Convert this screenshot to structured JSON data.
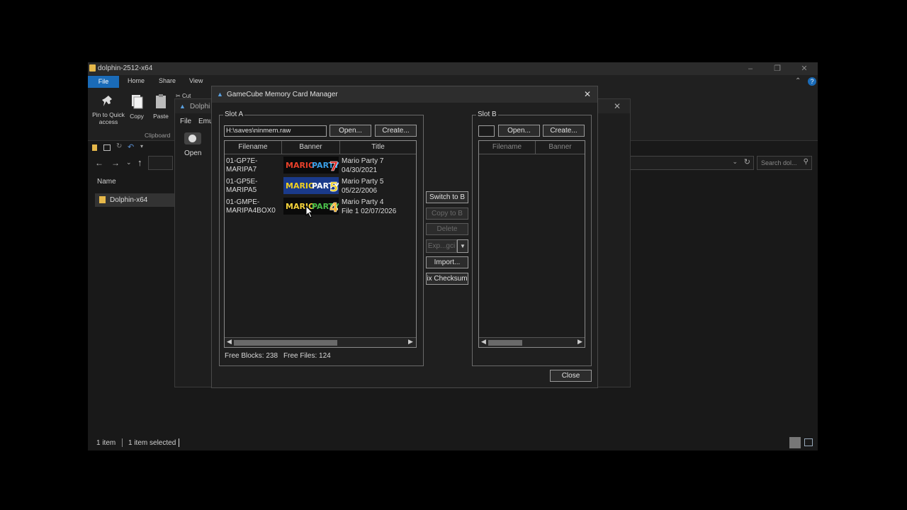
{
  "explorer": {
    "title": "dolphin-2512-x64",
    "tabs": [
      "File",
      "Home",
      "Share",
      "View"
    ],
    "ribbon": {
      "pin_label": "Pin to Quick access",
      "copy_label": "Copy",
      "paste_label": "Paste",
      "cut_label": "Cut",
      "group_label": "Clipboard"
    },
    "search_placeholder": "Search dol...",
    "column_name": "Name",
    "sidebar_item": "Dolphin-x64",
    "status_items": "1 item",
    "status_selected": "1 item selected"
  },
  "dolphin": {
    "title": "Dolphi",
    "menu_file": "File",
    "menu_emu": "Emu",
    "open_label": "Open"
  },
  "mcm": {
    "title": "GameCube Memory Card Manager",
    "slot_a": {
      "label": "Slot A",
      "path": "H:\\saves\\ninmem.raw",
      "open_btn": "Open...",
      "create_btn": "Create...",
      "columns": [
        "Filename",
        "Banner",
        "Title"
      ],
      "rows": [
        {
          "filename": "01-GP7E-\nMARIPA7",
          "banner": "MARIO PARTY 7",
          "title": "Mario Party 7",
          "date": "04/30/2021"
        },
        {
          "filename": "01-GP5E-\nMARIPA5",
          "banner": "MARIO PARTY 5",
          "title": "Mario Party 5",
          "date": "05/22/2006"
        },
        {
          "filename": "01-GMPE-\nMARIPA4BOX0",
          "banner": "MARIO PARTY 4",
          "title": "Mario Party 4",
          "date": "File 1  02/07/2026"
        }
      ],
      "free_blocks": "Free Blocks: 238",
      "free_files": "Free Files: 124"
    },
    "middle": {
      "switch": "Switch to B",
      "copy": "Copy to B",
      "delete": "Delete",
      "export": "Exp...gci",
      "import": "Import...",
      "fix": "ix Checksum"
    },
    "slot_b": {
      "label": "Slot B",
      "path": "",
      "open_btn": "Open...",
      "create_btn": "Create...",
      "columns": [
        "Filename",
        "Banner"
      ]
    },
    "close_btn": "Close"
  },
  "colors": {
    "accent": "#1a6bb8",
    "folder": "#e6b84a"
  }
}
